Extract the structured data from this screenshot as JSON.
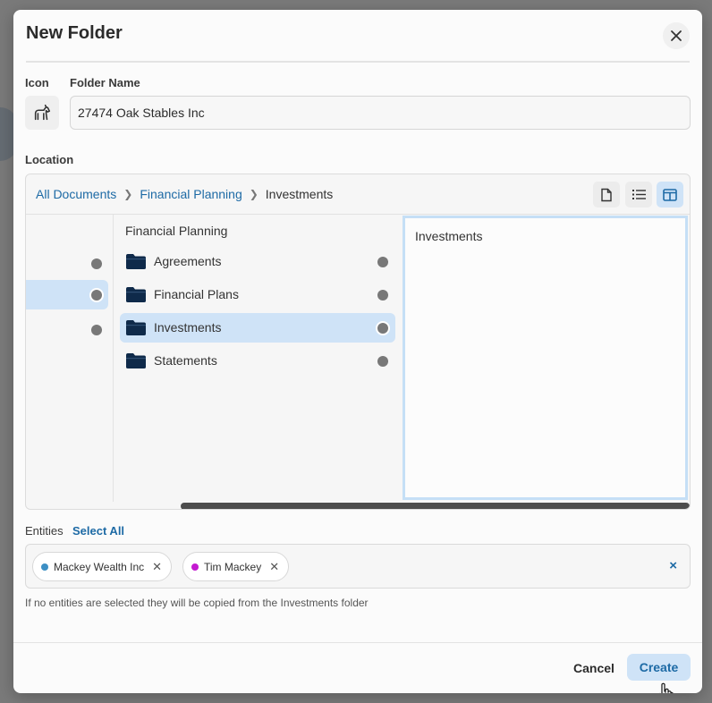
{
  "dialog": {
    "title": "New Folder"
  },
  "form": {
    "icon_label": "Icon",
    "folder_name_label": "Folder Name",
    "folder_name_value": "27474 Oak Stables Inc",
    "location_label": "Location"
  },
  "breadcrumb": [
    {
      "label": "All Documents"
    },
    {
      "label": "Financial Planning"
    },
    {
      "label": "Investments"
    }
  ],
  "browser": {
    "column2_title": "Financial Planning",
    "folders": [
      {
        "name": "Agreements",
        "selected": false
      },
      {
        "name": "Financial Plans",
        "selected": false
      },
      {
        "name": "Investments",
        "selected": true
      },
      {
        "name": "Statements",
        "selected": false
      }
    ],
    "preview_title": "Investments"
  },
  "entities": {
    "label": "Entities",
    "select_all": "Select All",
    "chips": [
      {
        "name": "Mackey Wealth Inc",
        "color": "#3d8fc4"
      },
      {
        "name": "Tim Mackey",
        "color": "#c41ad1"
      }
    ],
    "clear_symbol": "×",
    "hint": "If no entities are selected they will be copied from the Investments folder"
  },
  "footer": {
    "cancel_label": "Cancel",
    "create_label": "Create"
  },
  "colors": {
    "accent": "#1d6aa5",
    "selected_bg": "#cfe3f7",
    "folder_icon": "#0f2a4a"
  }
}
